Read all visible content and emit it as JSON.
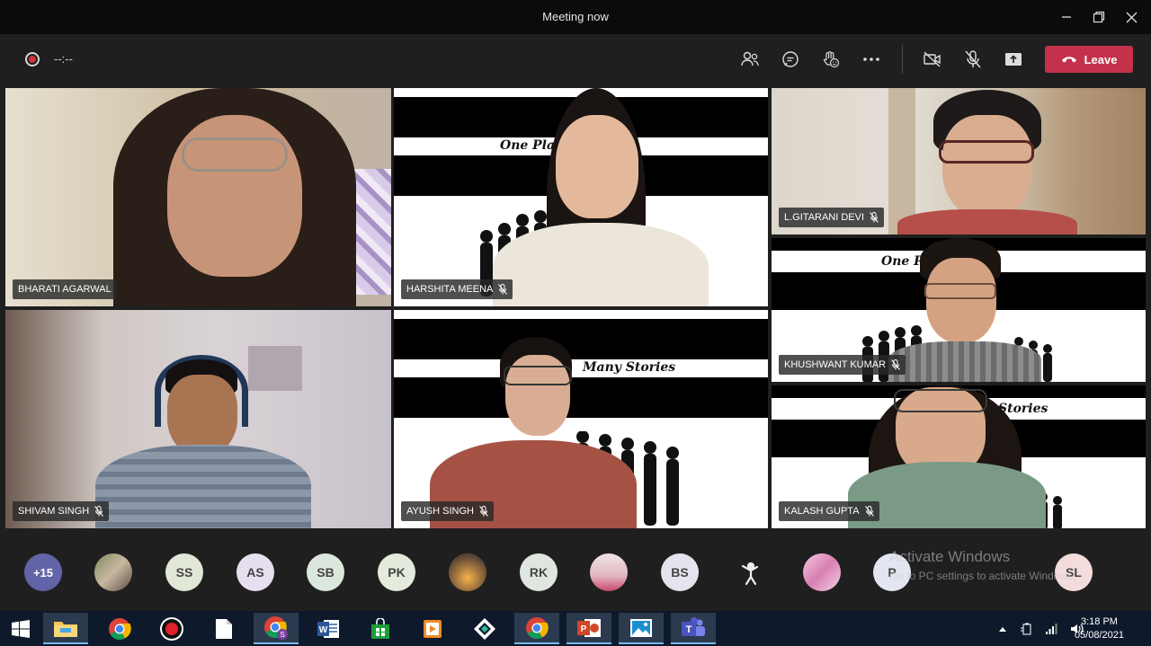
{
  "window": {
    "title": "Meeting now"
  },
  "toolbar": {
    "timer": "--:--",
    "leave_label": "Leave"
  },
  "tiles": [
    {
      "name": "BHARATI AGARWAL",
      "muted": false
    },
    {
      "name": "HARSHITA MEENA",
      "muted": true
    },
    {
      "name": "L.GITARANI DEVI",
      "muted": true
    },
    {
      "name": "KHUSHWANT KUMAR",
      "muted": true
    },
    {
      "name": "SHIVAM SINGH",
      "muted": true
    },
    {
      "name": "AYUSH SINGH",
      "muted": true
    },
    {
      "name": "KALASH GUPTA",
      "muted": true
    }
  ],
  "backgrounds": {
    "harshita_text": "One Plat        Stories",
    "khushwant_text": "One Pl          Stories",
    "ayush_text": "Many Stories",
    "kalash_text": "Stories"
  },
  "participants": {
    "overflow": "+15",
    "initials": [
      "SS",
      "AS",
      "SB",
      "PK",
      "RK",
      "BS",
      "P",
      "SL"
    ]
  },
  "watermark": {
    "line1": "Activate Windows",
    "line2": "Go to PC settings to activate Windows."
  },
  "taskbar": {
    "time": "3:18 PM",
    "date": "05/08/2021"
  },
  "colors": {
    "leave": "#c4314b",
    "record_dot": "#d13438",
    "overflow_avatar": "#6264a7"
  }
}
